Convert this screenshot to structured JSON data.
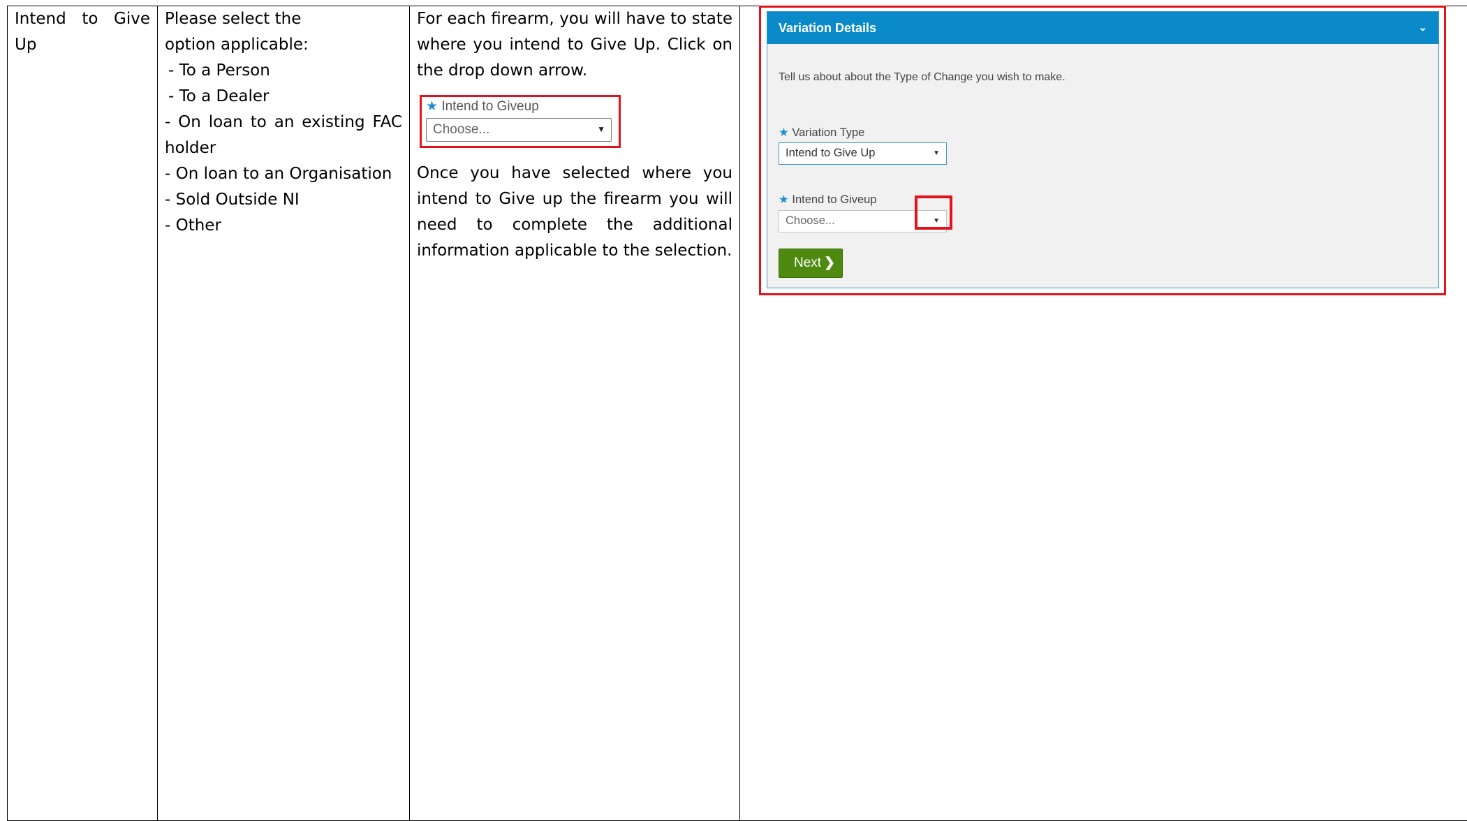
{
  "row": {
    "col1": [
      "Intend to Give",
      "Up"
    ],
    "col2": {
      "intro": "Please select the option applicable:",
      "options": [
        "- To a Person",
        "- To a Dealer",
        "- On loan to an existing FAC holder",
        "- On loan to an Organisation",
        "- Sold Outside NI",
        "- Other"
      ]
    },
    "col3": {
      "para1": "For each firearm, you will have to state where you intend to Give Up. Click on the drop down arrow.",
      "example_label": "Intend to Giveup",
      "example_placeholder": "Choose...",
      "para2": "Once you have selected where you intend to Give up the firearm you will need to complete the additional information applicable to the selection."
    }
  },
  "panel": {
    "title": "Variation Details",
    "intro": "Tell us about about the Type of Change you wish to make.",
    "variation_type_label": "Variation Type",
    "variation_type_value": "Intend to Give Up",
    "giveup_label": "Intend to Giveup",
    "giveup_placeholder": "Choose...",
    "next_label": "Next"
  },
  "colors": {
    "panel_header": "#0a8ac9",
    "highlight": "#e4121b",
    "next_button": "#4f8a10",
    "required_star": "#1b8fd1"
  },
  "icons": [
    "chevron-down-icon",
    "dropdown-arrow-icon",
    "chevron-right-icon",
    "star-icon"
  ]
}
